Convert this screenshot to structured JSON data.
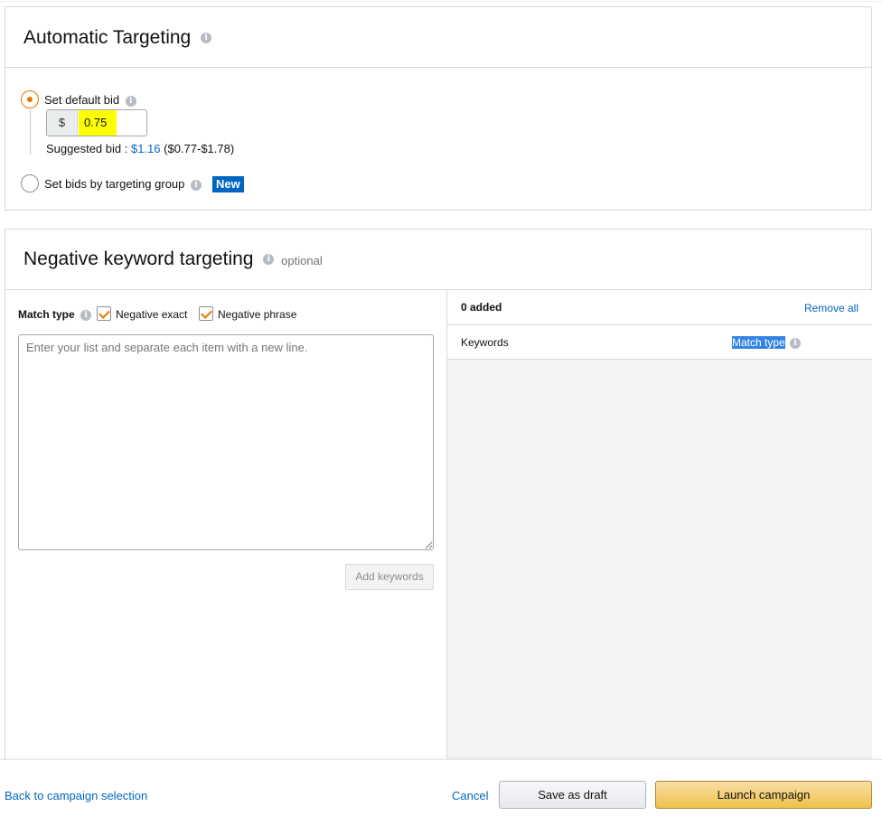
{
  "auto_targeting": {
    "title": "Automatic Targeting",
    "default_bid_label": "Set default bid",
    "currency": "$",
    "bid_value": "0.75",
    "suggested_label": "Suggested bid : ",
    "suggested_value": "$1.16",
    "suggested_range": "($0.77-$1.78)",
    "group_bid_label": "Set bids by targeting group",
    "new_badge": "New"
  },
  "negative_targeting": {
    "title": "Negative keyword targeting",
    "optional": "optional",
    "match_type_label": "Match type",
    "negative_exact_label": "Negative exact",
    "negative_phrase_label": "Negative phrase",
    "textarea_placeholder": "Enter your list and separate each item with a new line.",
    "add_keywords_label": "Add keywords",
    "added_count": "0 added",
    "remove_all": "Remove all",
    "col_keywords": "Keywords",
    "col_match_type": "Match type"
  },
  "footer": {
    "back_link": "Back to campaign selection",
    "cancel": "Cancel",
    "save_draft": "Save as draft",
    "launch": "Launch campaign"
  },
  "colors": {
    "accent": "#e77600",
    "link": "#0066c0",
    "launch_button": "#f0c14b",
    "bid_highlight": "#ffff00"
  }
}
